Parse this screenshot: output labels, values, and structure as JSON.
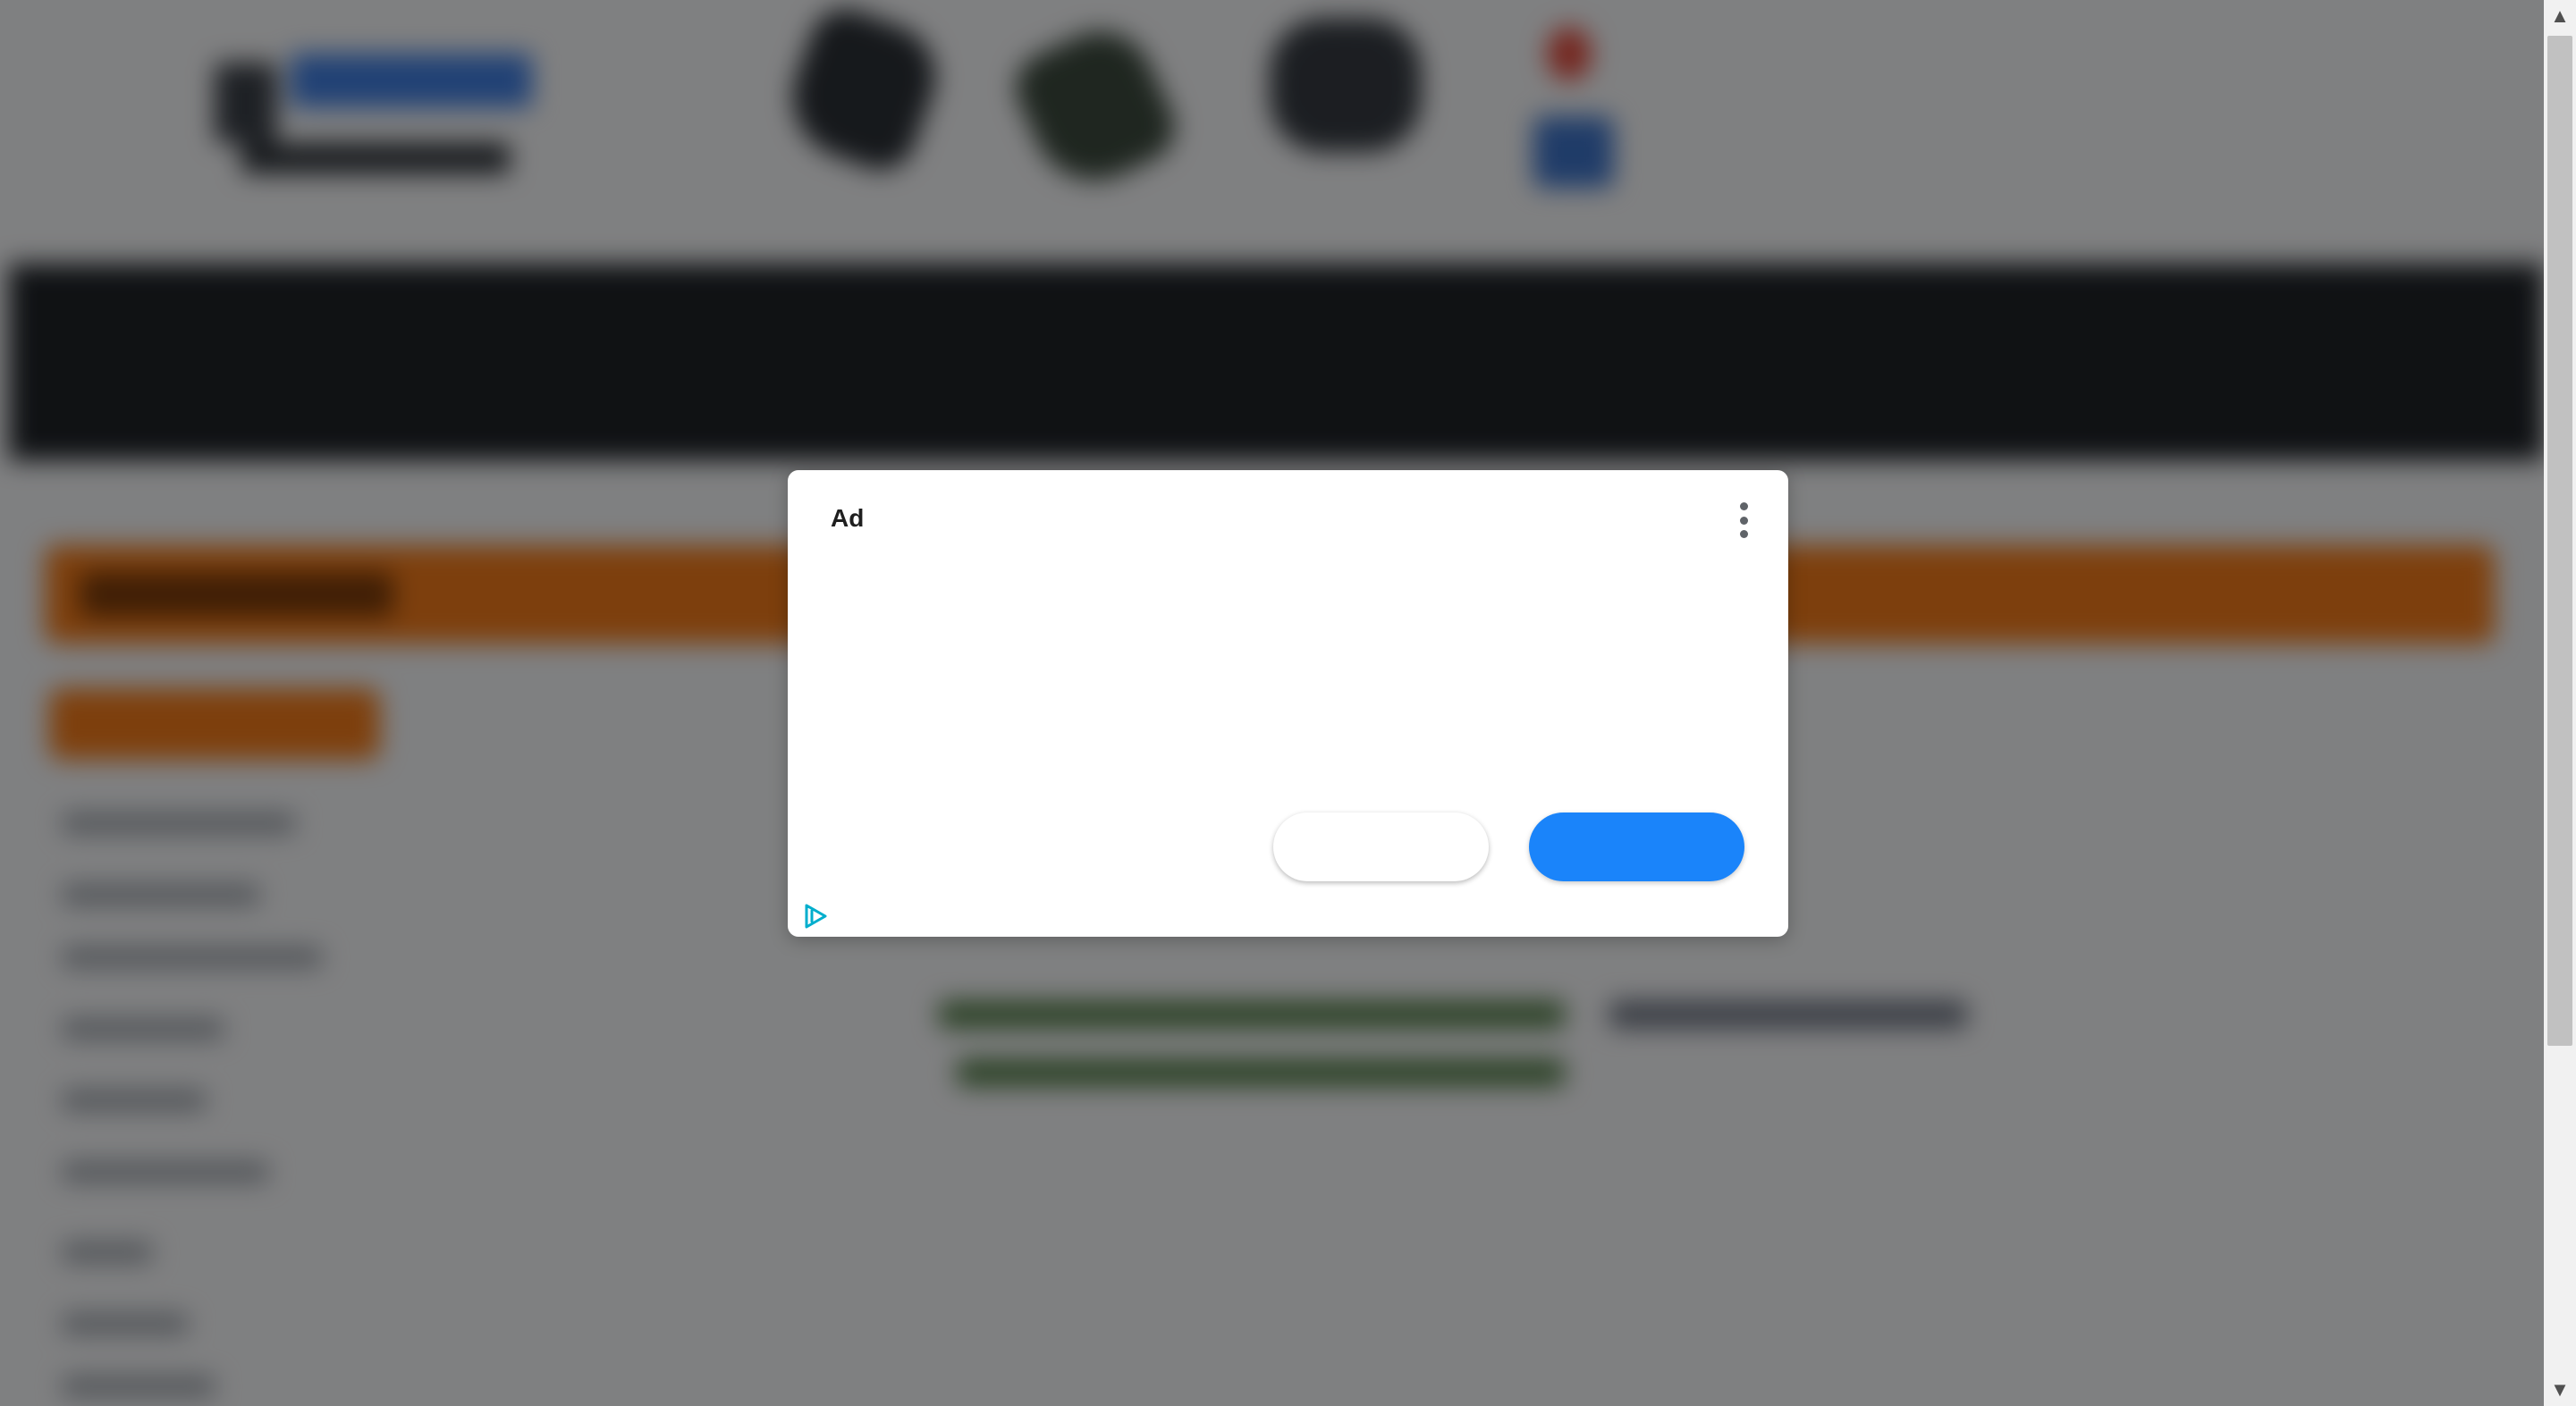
{
  "ad_dialog": {
    "label": "Ad",
    "menu_icon": "more-vert-icon",
    "adchoices_icon": "adchoices-icon",
    "secondary_button_label": "",
    "primary_button_label": "",
    "colors": {
      "primary_button": "#1a84fa",
      "secondary_button": "#ffffff",
      "adchoices": "#00aecd"
    }
  },
  "background_page": {
    "overlay_color": "rgba(0,0,0,0.48)",
    "accent_orange": "#f07a1a",
    "nav_dark": "#1f2328"
  },
  "scrollbar": {
    "up_icon": "scroll-up-arrow-icon",
    "down_icon": "scroll-down-arrow-icon"
  }
}
